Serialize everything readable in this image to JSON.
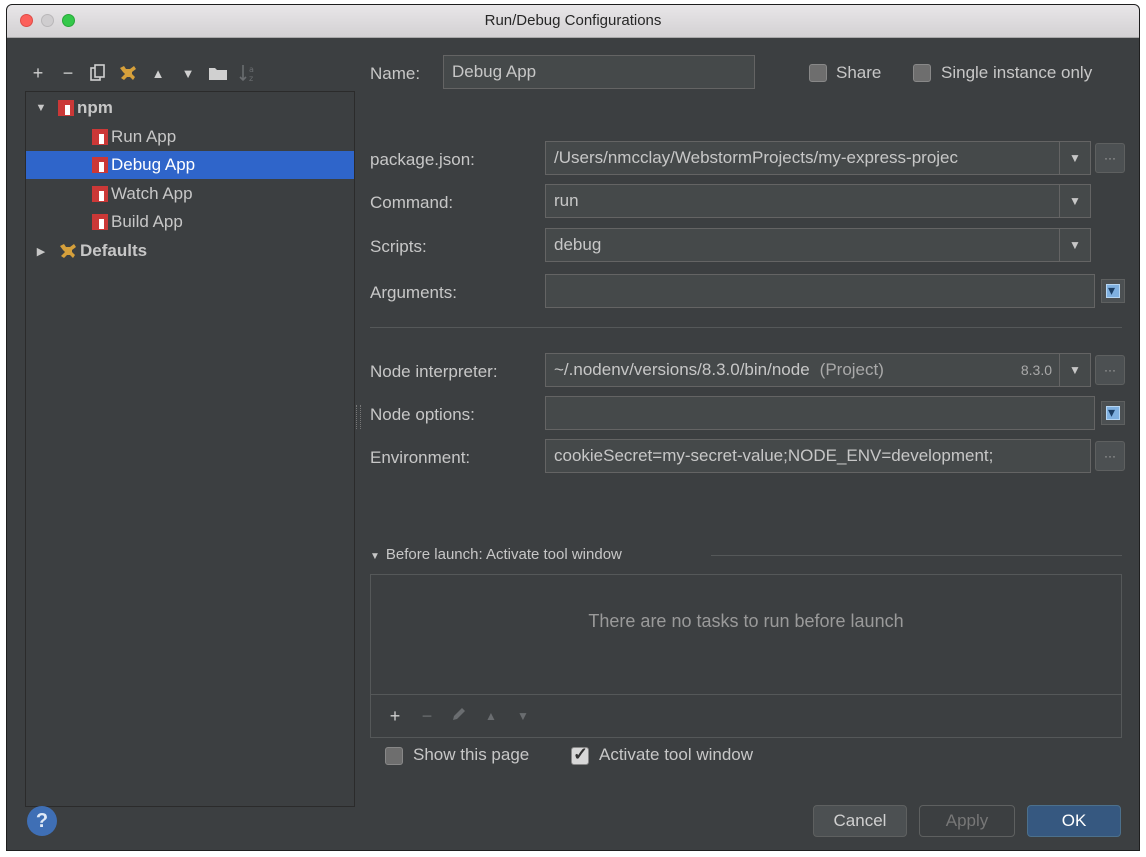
{
  "window": {
    "title": "Run/Debug Configurations"
  },
  "left_toolbar": {
    "buttons": [
      "+",
      "−",
      "copy-icon",
      "wrench-icon",
      "▲",
      "▼",
      "folder-icon",
      "sort-icon"
    ]
  },
  "tree": {
    "groups": [
      {
        "label": "npm",
        "expanded": true,
        "items": [
          "Run App",
          "Debug App",
          "Watch App",
          "Build App"
        ],
        "selected_index": 1
      },
      {
        "label": "Defaults",
        "expanded": false
      }
    ]
  },
  "header": {
    "name_label": "Name:",
    "name_value": "Debug App",
    "share_label": "Share",
    "share_checked": false,
    "single_instance_label": "Single instance only",
    "single_instance_checked": false
  },
  "form": {
    "package_json_label": "package.json:",
    "package_json_value": "/Users/nmcclay/WebstormProjects/my-express-projec",
    "command_label": "Command:",
    "command_value": "run",
    "scripts_label": "Scripts:",
    "scripts_value": "debug",
    "arguments_label": "Arguments:",
    "arguments_value": "",
    "node_interpreter_label": "Node interpreter:",
    "node_interpreter_value": "~/.nodenv/versions/8.3.0/bin/node",
    "node_interpreter_scope": "(Project)",
    "node_interpreter_version": "8.3.0",
    "node_options_label": "Node options:",
    "node_options_value": "",
    "environment_label": "Environment:",
    "environment_value": "cookieSecret=my-secret-value;NODE_ENV=development;"
  },
  "before_launch": {
    "header": "Before launch: Activate tool window",
    "empty_text": "There are no tasks to run before launch",
    "show_page_label": "Show this page",
    "show_page_checked": false,
    "activate_tool_window_label": "Activate tool window",
    "activate_tool_window_checked": true
  },
  "footer": {
    "help": "?",
    "cancel": "Cancel",
    "apply": "Apply",
    "ok": "OK"
  },
  "colors": {
    "background": "#3c3f41",
    "selection": "#2f65ca",
    "ok_button": "#365880",
    "npm_icon": "#cb3837"
  }
}
